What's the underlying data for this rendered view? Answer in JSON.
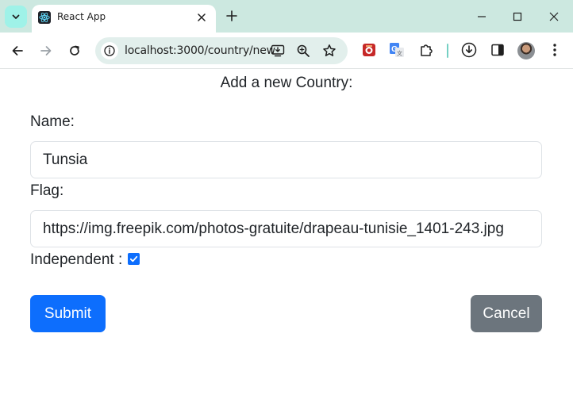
{
  "browser": {
    "tab_title": "React App",
    "url": "localhost:3000/country/new",
    "accent_color": "#cce8e0",
    "icons": {
      "tab_search": "chevron-down-icon",
      "favicon": "react-logo-icon",
      "tab_close": "close-icon",
      "new_tab": "plus-icon",
      "minimize": "minimize-icon",
      "maximize": "maximize-icon",
      "close_window": "close-icon",
      "back": "back-arrow-icon",
      "forward": "forward-arrow-icon",
      "reload": "reload-icon",
      "site_info": "site-info-icon",
      "install": "install-app-icon",
      "zoom": "zoom-icon",
      "bookmark": "star-icon",
      "extensions": [
        "extension-red-icon",
        "translate-icon",
        "puzzle-icon"
      ],
      "download": "download-icon",
      "side_panel": "side-panel-icon",
      "profile": "avatar",
      "menu": "kebab-menu-icon"
    }
  },
  "form": {
    "title": "Add a new Country:",
    "name_label": "Name:",
    "name_value": "Tunsia",
    "flag_label": "Flag:",
    "flag_value": "https://img.freepik.com/photos-gratuite/drapeau-tunisie_1401-243.jpg",
    "independent_label": "Independent :",
    "independent_checked": true,
    "submit_label": "Submit",
    "cancel_label": "Cancel",
    "colors": {
      "primary": "#0d6efd",
      "secondary": "#6c757d",
      "text": "#212529"
    }
  }
}
